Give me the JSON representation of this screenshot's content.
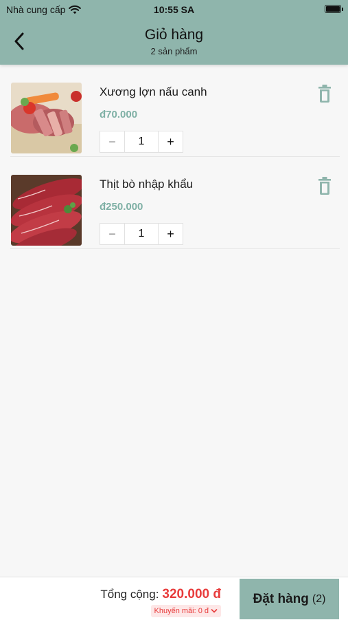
{
  "status_bar": {
    "carrier": "Nhà cung cấp",
    "time": "10:55 SA",
    "wifi_icon": "wifi-icon",
    "battery_icon": "battery-icon"
  },
  "nav": {
    "back_icon": "chevron-left-icon",
    "title": "Giỏ hàng",
    "subtitle": "2 sản phẩm"
  },
  "cart": {
    "items": [
      {
        "name": "Xương lợn nấu canh",
        "price": "đ70.000",
        "quantity": "1",
        "minus": "−",
        "plus": "+",
        "delete_icon": "trash-icon"
      },
      {
        "name": "Thịt bò nhập khẩu",
        "price": "đ250.000",
        "quantity": "1",
        "minus": "−",
        "plus": "+",
        "delete_icon": "trash-icon"
      }
    ]
  },
  "footer": {
    "total_label": "Tổng cộng:",
    "total_value": "320.000 đ",
    "promo_label": "Khuyến mãi: 0 đ",
    "order_label": "Đặt hàng",
    "order_count": "(2)"
  },
  "colors": {
    "header": "#8fb5ac",
    "price": "#7fb0a5",
    "total": "#e83b3b",
    "promo_bg": "#fde7e7"
  }
}
